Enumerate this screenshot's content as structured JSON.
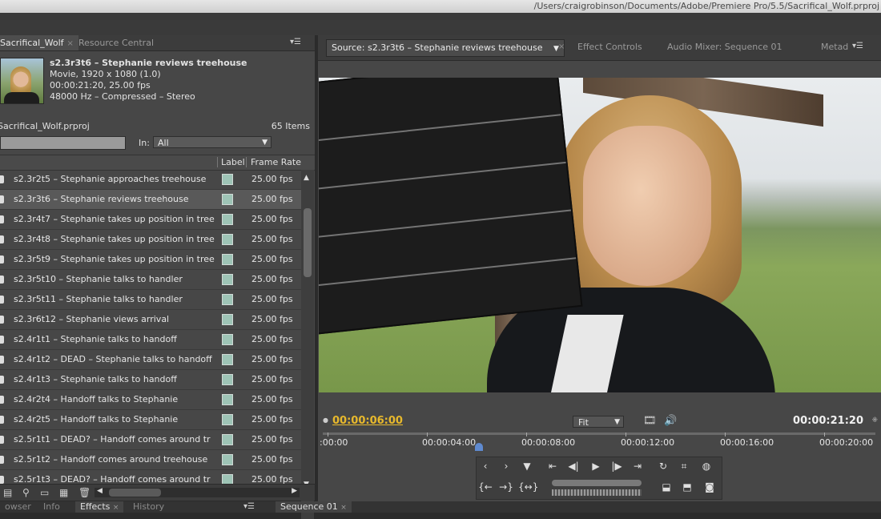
{
  "window": {
    "path": "/Users/craigrobinson/Documents/Adobe/Premiere Pro/5.5/Sacrifical_Wolf.prproj"
  },
  "project_panel": {
    "tabs": [
      {
        "label": "Sacrifical_Wolf",
        "active": true
      },
      {
        "label": "Resource Central",
        "active": false
      }
    ],
    "clip_info": {
      "title": "s2.3r3t6 – Stephanie reviews treehouse",
      "line1": "Movie, 1920 x 1080 (1.0)",
      "line2": "00:00:21:20, 25.00 fps",
      "line3": "48000 Hz – Compressed – Stereo"
    },
    "project_name": "Sacrifical_Wolf.prproj",
    "item_count": "65 Items",
    "in_label": "In:",
    "in_value": "All",
    "columns": {
      "label": "Label",
      "frame_rate": "Frame Rate"
    },
    "items": [
      {
        "name": "s2.3r2t5 – Stephanie approaches treehouse",
        "fps": "25.00 fps"
      },
      {
        "name": "s2.3r3t6 – Stephanie reviews treehouse",
        "fps": "25.00 fps",
        "selected": true
      },
      {
        "name": "s2.3r4t7 – Stephanie takes up position in tree",
        "fps": "25.00 fps"
      },
      {
        "name": "s2.3r4t8 – Stephanie takes up position in tree",
        "fps": "25.00 fps"
      },
      {
        "name": "s2.3r5t9 – Stephanie takes up position in tree",
        "fps": "25.00 fps"
      },
      {
        "name": "s2.3r5t10 – Stephanie talks to handler",
        "fps": "25.00 fps"
      },
      {
        "name": "s2.3r5t11 – Stephanie talks to handler",
        "fps": "25.00 fps"
      },
      {
        "name": "s2.3r6t12 – Stephanie views arrival",
        "fps": "25.00 fps"
      },
      {
        "name": "s2.4r1t1 – Stephanie talks to handoff",
        "fps": "25.00 fps"
      },
      {
        "name": "s2.4r1t2 – DEAD – Stephanie talks to handoff",
        "fps": "25.00 fps"
      },
      {
        "name": "s2.4r1t3 – Stephanie talks to handoff",
        "fps": "25.00 fps"
      },
      {
        "name": "s2.4r2t4 – Handoff talks to Stephanie",
        "fps": "25.00 fps"
      },
      {
        "name": "s2.4r2t5 – Handoff talks to Stephanie",
        "fps": "25.00 fps"
      },
      {
        "name": "s2.5r1t1 – DEAD? – Handoff comes around tr",
        "fps": "25.00 fps"
      },
      {
        "name": "s2.5r1t2 – Handoff comes around treehouse",
        "fps": "25.00 fps"
      },
      {
        "name": "s2.5r1t3 – DEAD? – Handoff comes around tr",
        "fps": "25.00 fps"
      }
    ],
    "label_color": "#9ec4b6"
  },
  "monitor": {
    "tabs": [
      {
        "label": "Source: s2.3r3t6 – Stephanie reviews treehouse",
        "active": true
      },
      {
        "label": "Effect Controls",
        "active": false
      },
      {
        "label": "Audio Mixer: Sequence 01",
        "active": false
      },
      {
        "label": "Metad",
        "active": false
      }
    ],
    "current_timecode": "00:00:06:00",
    "duration_timecode": "00:00:21:20",
    "zoom": "Fit",
    "ruler": [
      ":00:00",
      "00:00:04:00",
      "00:00:08:00",
      "00:00:12:00",
      "00:00:16:00",
      "00:00:20:00"
    ],
    "playhead_fraction": 0.276,
    "accent_color": "#e8b92c"
  },
  "dock": {
    "tabs": [
      {
        "label": "owser",
        "active": false
      },
      {
        "label": "Info",
        "active": false
      },
      {
        "label": "Effects",
        "active": true
      },
      {
        "label": "History",
        "active": false
      },
      {
        "label": "Sequence 01",
        "active": false
      }
    ]
  }
}
